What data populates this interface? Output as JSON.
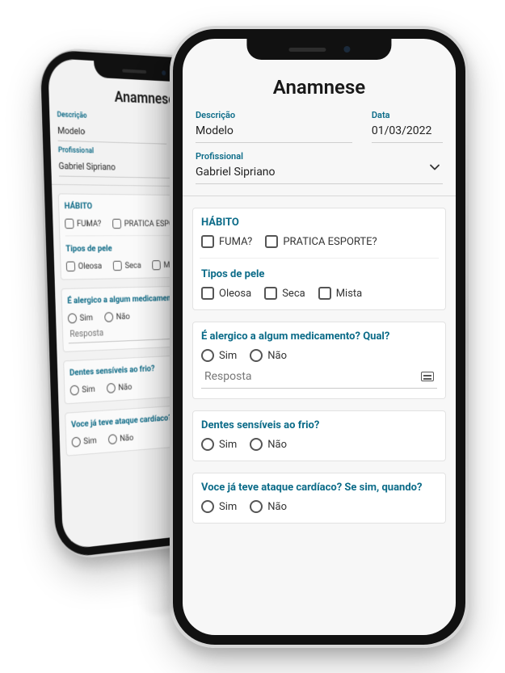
{
  "title": "Anamnese",
  "labels": {
    "descricao": "Descrição",
    "data": "Data",
    "profissional": "Profissional"
  },
  "values": {
    "descricao": "Modelo",
    "data": "01/03/2022",
    "profissional": "Gabriel Sipriano"
  },
  "resposta_placeholder": "Resposta",
  "sections": {
    "habito": {
      "title": "HÁBITO",
      "items": [
        "FUMA?",
        "PRATICA ESPORTE?"
      ]
    },
    "pele": {
      "title": "Tipos de pele",
      "items": [
        "Oleosa",
        "Seca",
        "Mista"
      ]
    },
    "alergico": {
      "title": "É alergico a algum medicamento? Qual?",
      "options": [
        "Sim",
        "Não"
      ]
    },
    "frio": {
      "title": "Dentes sensíveis ao frio?",
      "options": [
        "Sim",
        "Não"
      ]
    },
    "cardiaco": {
      "title": "Voce já teve ataque cardíaco? Se sim, quando?",
      "options": [
        "Sim",
        "Não"
      ]
    }
  }
}
